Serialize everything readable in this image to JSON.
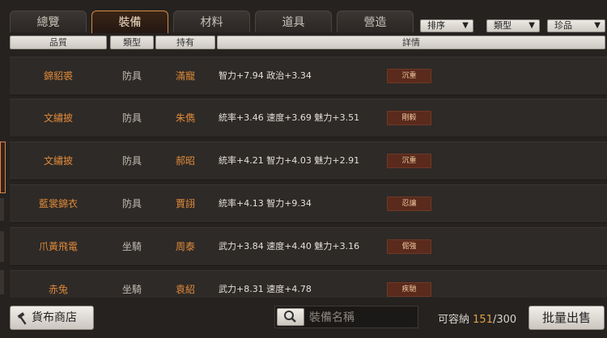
{
  "tabs": [
    {
      "label": "總覽",
      "active": false
    },
    {
      "label": "裝備",
      "active": true
    },
    {
      "label": "材料",
      "active": false
    },
    {
      "label": "道具",
      "active": false
    },
    {
      "label": "營造",
      "active": false
    }
  ],
  "filters": [
    {
      "label": "排序"
    },
    {
      "label": "類型"
    },
    {
      "label": "珍品"
    }
  ],
  "header": {
    "quality": "品質",
    "type": "類型",
    "holder": "持有",
    "details": "詳情"
  },
  "rows": [
    {
      "name": "錦貂裘",
      "type": "防具",
      "holder": "滿寵",
      "details": "智力+7.94  政治+3.34",
      "trait": "沉重"
    },
    {
      "name": "文繡披",
      "type": "防具",
      "holder": "朱儁",
      "details": "統率+3.46  速度+3.69  魅力+3.51",
      "trait": "剛毅"
    },
    {
      "name": "文繡披",
      "type": "防具",
      "holder": "郝昭",
      "details": "統率+4.21  智力+4.03  魅力+2.91",
      "trait": "沉重"
    },
    {
      "name": "藍裳錦衣",
      "type": "防具",
      "holder": "賈詡",
      "details": "統率+4.13  智力+9.34",
      "trait": "忍讓"
    },
    {
      "name": "爪黃飛電",
      "type": "坐騎",
      "holder": "周泰",
      "details": "武力+3.84  速度+4.40  魅力+3.16",
      "trait": "倔強"
    },
    {
      "name": "赤兔",
      "type": "坐騎",
      "holder": "袁紹",
      "details": "武力+8.31  速度+4.78",
      "trait": "疾馳"
    }
  ],
  "footer": {
    "shop_label": "貨布商店",
    "search_placeholder": "裝備名稱",
    "capacity_label": "可容納",
    "capacity_current": "151",
    "capacity_sep": "/300",
    "sell_label": "批量出售"
  },
  "colors": {
    "accent": "#e08a3a",
    "tab_active_border": "#d48a44",
    "trait_bg": "#5a2a1c"
  }
}
